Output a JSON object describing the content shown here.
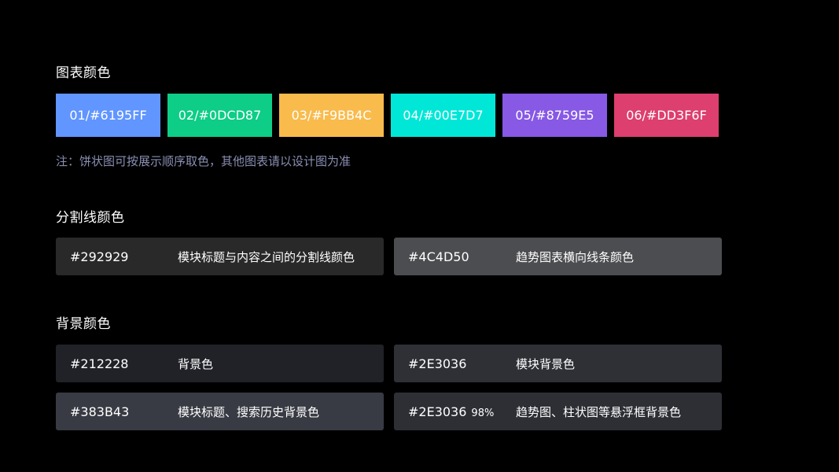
{
  "chart_colors": {
    "title": "图表颜色",
    "swatches": [
      {
        "label": "01/#6195FF",
        "color": "#6195FF"
      },
      {
        "label": "02/#0DCD87",
        "color": "#0DCD87"
      },
      {
        "label": "03/#F9BB4C",
        "color": "#F9BB4C"
      },
      {
        "label": "04/#00E7D7",
        "color": "#00E7D7"
      },
      {
        "label": "05/#8759E5",
        "color": "#8759E5"
      },
      {
        "label": "06/#DD3F6F",
        "color": "#DD3F6F"
      }
    ],
    "note": "注：饼状图可按展示顺序取色，其他图表请以设计图为准"
  },
  "divider_colors": {
    "title": "分割线颜色",
    "items": [
      {
        "code": "#292929",
        "desc": "模块标题与内容之间的分割线颜色",
        "color": "#292929"
      },
      {
        "code": "#4C4D50",
        "desc": "趋势图表横向线条颜色",
        "color": "#4C4D50"
      }
    ]
  },
  "background_colors": {
    "title": "背景颜色",
    "items": [
      {
        "code": "#212228",
        "alpha": "",
        "desc": "背景色",
        "color": "#212228"
      },
      {
        "code": "#2E3036",
        "alpha": "",
        "desc": "模块背景色",
        "color": "#2E3036"
      },
      {
        "code": "#383B43",
        "alpha": "",
        "desc": "模块标题、搜索历史背景色",
        "color": "#383B43"
      },
      {
        "code": "#2E3036",
        "alpha": "98%",
        "desc": "趋势图、柱状图等悬浮框背景色",
        "color": "#2E3036"
      }
    ]
  }
}
